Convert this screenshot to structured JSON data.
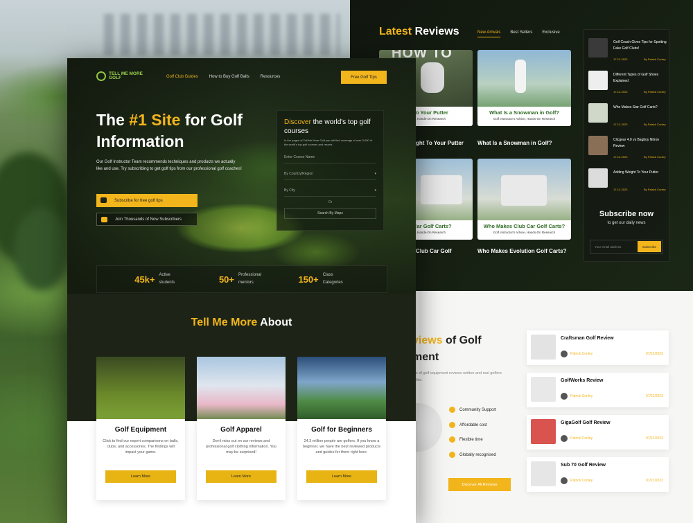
{
  "brand": {
    "logo_text": "TELL ME MORE GOLF"
  },
  "nav": {
    "items": [
      "Golf Club Guides",
      "How to Buy Golf Balls",
      "Resources"
    ],
    "cta": "Free Golf Tips"
  },
  "hero": {
    "title_pre": "The ",
    "title_highlight": "#1 Site",
    "title_post": " for Golf Information",
    "description": "Our Golf Instructor Team recommends techniques and products we actually like and use. Try subscribing to get golf tips from our professional golf coaches!",
    "subscribe_button": "Subscribe for free golf tips",
    "join_button": "Join Thousands of Now Subscribers"
  },
  "search": {
    "title_highlight": "Discover",
    "title_rest": " the world's top golf courses",
    "description": "In the pages of Tell Me More Golf you will find coverage of over 3,000 of the world's top golf courses and resorts.",
    "course_name_placeholder": "Enter Course Name",
    "country_placeholder": "By Country/Region",
    "city_placeholder": "By City",
    "or_label": "Or",
    "maps_button": "Search By Maps"
  },
  "stats": [
    {
      "value": "45k+",
      "label": "Active students"
    },
    {
      "value": "50+",
      "label": "Professional mentors"
    },
    {
      "value": "150+",
      "label": "Class Categories"
    }
  ],
  "about": {
    "title_highlight": "Tell Me More",
    "title_rest": " About"
  },
  "cards": [
    {
      "title": "Golf Equipment",
      "description": "Click to find our expert comparisons on balls, clubs, and accessories. The findings will impact your game.",
      "button": "Learn More"
    },
    {
      "title": "Golf Apparel",
      "description": "Don't miss out on our reviews and professional golf clothing information. You may be surprised!",
      "button": "Learn More"
    },
    {
      "title": "Golf for Beginners",
      "description": "24.3 million people are golfers. If you know a beginner, we have the best reviewed products and guides for them right here.",
      "button": "Learn More"
    }
  ],
  "latest_reviews": {
    "title_highlight": "Latest",
    "title_rest": " Reviews",
    "tabs": [
      "New Arrivals",
      "Best Sellers",
      "Exclusive"
    ],
    "overlay_howto": "HOW TO",
    "items": [
      {
        "caption": "ght To Your Putter",
        "cap_sub": "Advice, Hands-On Research",
        "title": "ght To Your Putter"
      },
      {
        "caption": "What Is a Snowman in Golf?",
        "cap_sub": "Golf Instructor's Advice, Hands-On Research",
        "title": "What Is a Snowman in Golf?"
      },
      {
        "caption": "Club Car Golf Carts?",
        "cap_sub": "Advice, Hands-On Research",
        "title": "Club Car Golf"
      },
      {
        "caption": "Who Makes Club Car Golf Carts?",
        "cap_sub": "Golf Instructor's Advice, Hands-On Research",
        "title": "Who Makes Evolution Golf Carts?"
      }
    ]
  },
  "sidebar": {
    "items": [
      {
        "title": "Golf Coach Gives Tips for Spotting Fake Golf Clubs!",
        "date": "17-12-2023",
        "author": "By Patrick Conley"
      },
      {
        "title": "Different Types of Golf Shoes Explained",
        "date": "17-12-2023",
        "author": "By Patrick Conley"
      },
      {
        "title": "Who Makes Star Golf Carts?",
        "date": "17-12-2023",
        "author": "By Patrick Conley"
      },
      {
        "title": "Clicgear 4.0 vs Bagboy Nitron Review",
        "date": "17-12-2023",
        "author": "By Patrick Conley"
      },
      {
        "title": "Adding Weight To Your Putter",
        "date": "17-12-2023",
        "author": "By Patrick Conley"
      }
    ],
    "subscribe_title": "Subscribe now",
    "subscribe_desc": "to get our daily news",
    "email_placeholder": "Your email address",
    "subscribe_button": "Subscribe"
  },
  "reviews_section": {
    "title_highlight": "views",
    "title_rest": " of Golf",
    "title_line2": "ment",
    "description": "ds of golf equipment reviews written and real golfers alike.",
    "features": [
      "Community Support",
      "Affordable cost",
      "Flexible time",
      "Globally recognised"
    ],
    "discover_button": "Discover All Reviews",
    "list": [
      {
        "title": "Craftsman Golf Review",
        "author": "Patrick Conley",
        "date": "07/21/2023"
      },
      {
        "title": "GolfWorks Review",
        "author": "Patrick Conley",
        "date": "07/21/2023"
      },
      {
        "title": "GigaGolf Golf Review",
        "author": "Patrick Conley",
        "date": "07/21/2023"
      },
      {
        "title": "Sub 70 Golf Review",
        "author": "Patrick Conley",
        "date": "07/21/2023"
      }
    ]
  }
}
